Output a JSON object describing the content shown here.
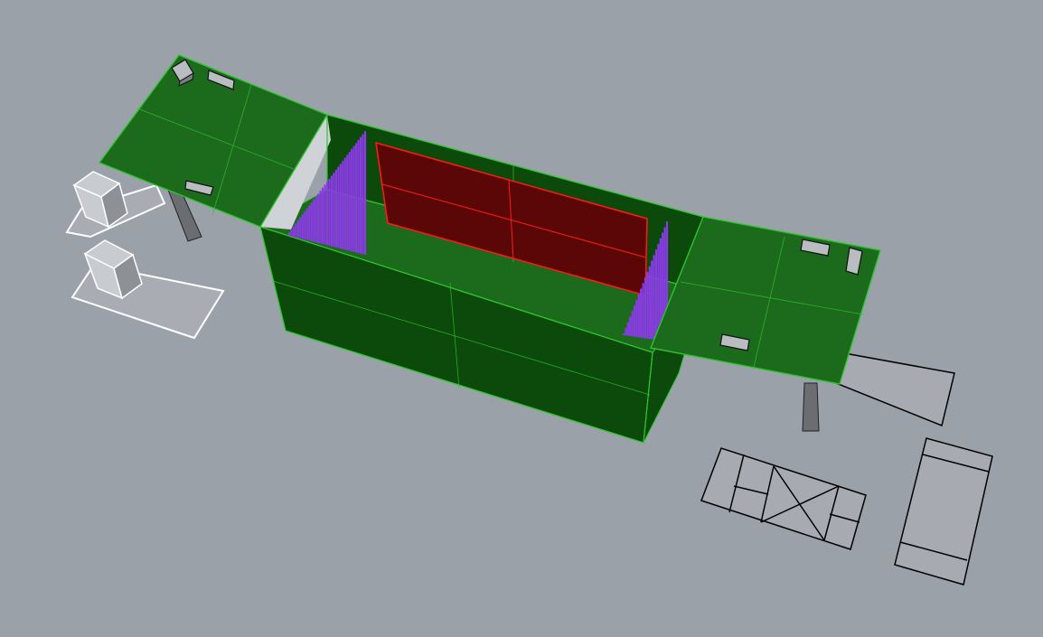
{
  "viewport": {
    "background": "#9aa1a9",
    "shading": "shaded",
    "objects": {
      "main_box": {
        "face_color": "#0b4a0b",
        "wire_color": "#2fc42f",
        "label": ""
      },
      "screen": {
        "fill": "#5c0707",
        "edge": "#ff1a1a"
      },
      "acoustic_panels": {
        "color": "#8a3be6"
      },
      "side_wings": {
        "face_color": "#1c6b1c",
        "wire_color": "#2fc42f"
      },
      "table_legs": {
        "color": "#6b6e70"
      },
      "furniture_outline": {
        "stroke": "#000000",
        "fill": "#a7abb1"
      },
      "selected_outline": {
        "stroke": "#ffffff"
      },
      "equipment_boxes": {
        "color": "#b9bcc0"
      }
    }
  }
}
